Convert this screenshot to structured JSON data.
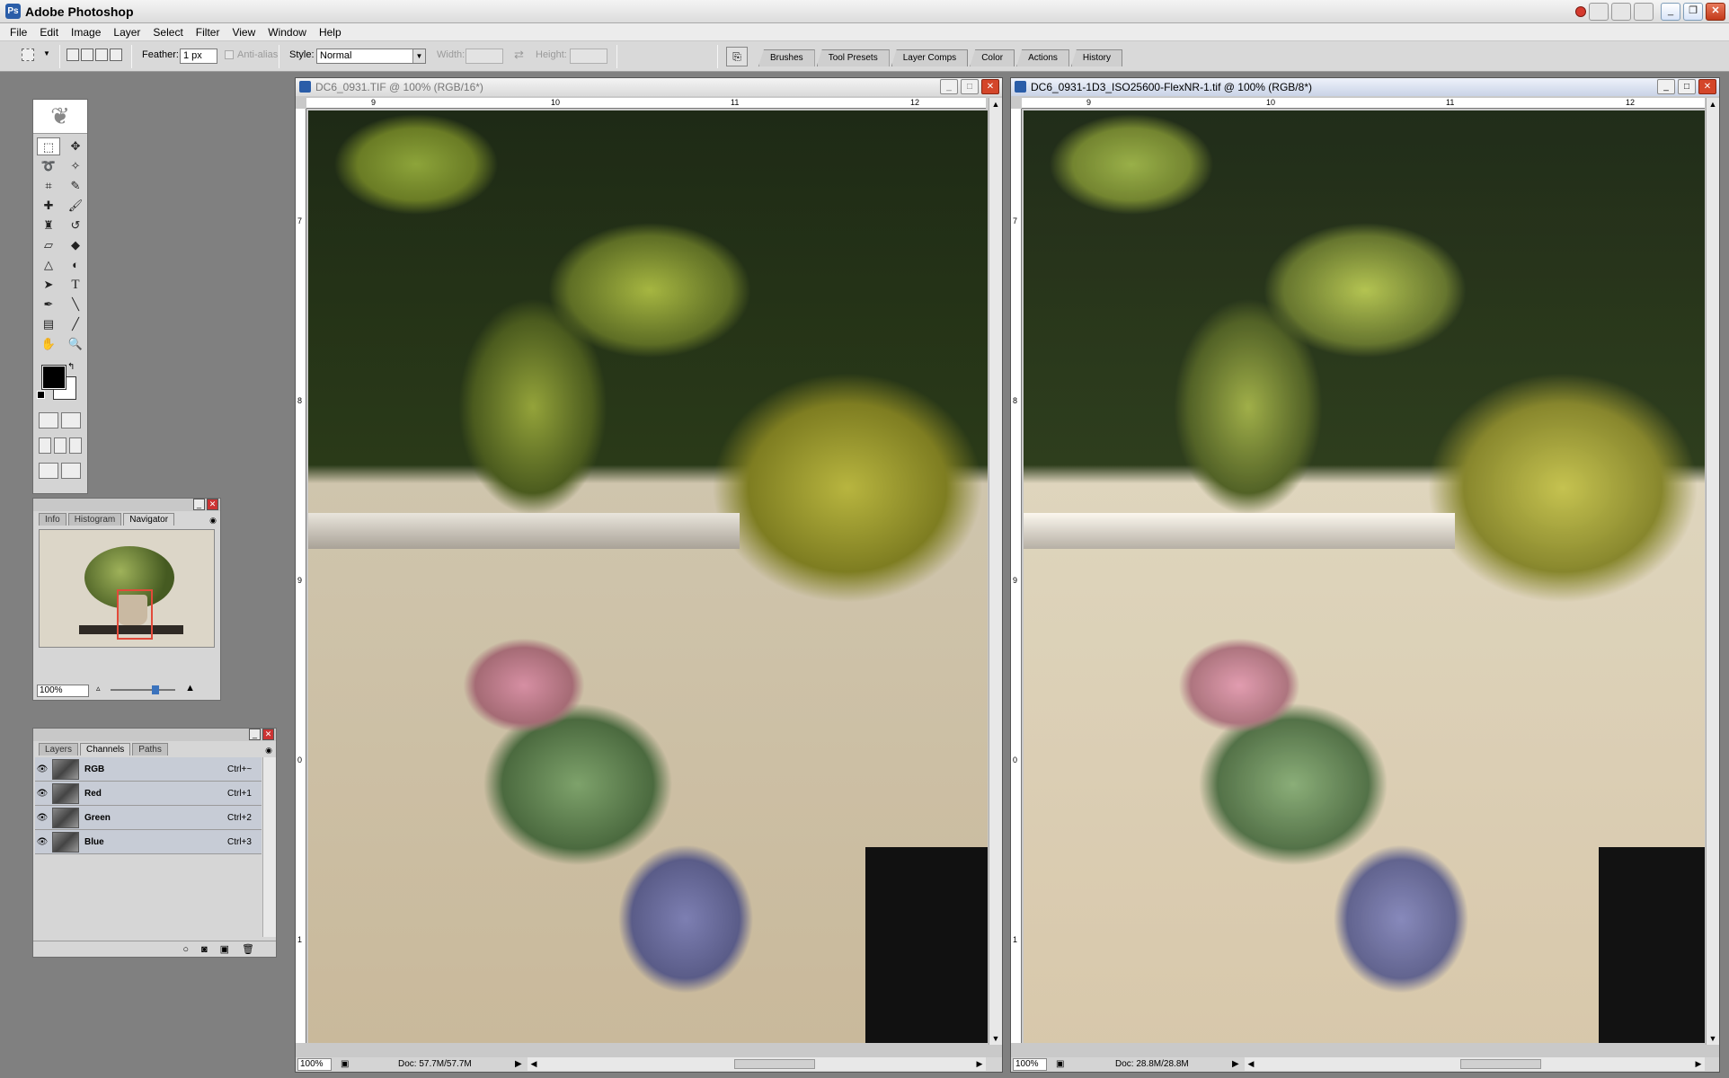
{
  "app": {
    "title": "Adobe Photoshop"
  },
  "menu": [
    "File",
    "Edit",
    "Image",
    "Layer",
    "Select",
    "Filter",
    "View",
    "Window",
    "Help"
  ],
  "options": {
    "feather_label": "Feather:",
    "feather_value": "1 px",
    "antialias_label": "Anti-alias",
    "style_label": "Style:",
    "style_value": "Normal",
    "width_label": "Width:",
    "height_label": "Height:"
  },
  "palette_well": [
    "Brushes",
    "Tool Presets",
    "Layer Comps",
    "Color",
    "Actions",
    "History"
  ],
  "navigator_panel": {
    "tabs": [
      "Info",
      "Histogram",
      "Navigator"
    ],
    "active_tab": "Navigator",
    "zoom": "100%"
  },
  "channels_panel": {
    "tabs": [
      "Layers",
      "Channels",
      "Paths"
    ],
    "active_tab": "Channels",
    "channels": [
      {
        "name": "RGB",
        "shortcut": "Ctrl+~"
      },
      {
        "name": "Red",
        "shortcut": "Ctrl+1"
      },
      {
        "name": "Green",
        "shortcut": "Ctrl+2"
      },
      {
        "name": "Blue",
        "shortcut": "Ctrl+3"
      }
    ]
  },
  "documents": [
    {
      "title": "DC6_0931.TIF @ 100% (RGB/16*)",
      "zoom": "100%",
      "doc_size": "Doc: 57.7M/57.7M",
      "active": false,
      "ruler_h": [
        "9",
        "10",
        "11",
        "12"
      ],
      "ruler_v": [
        "7",
        "8",
        "9",
        "0",
        "1"
      ]
    },
    {
      "title": "DC6_0931-1D3_ISO25600-FlexNR-1.tif @ 100% (RGB/8*)",
      "zoom": "100%",
      "doc_size": "Doc: 28.8M/28.8M",
      "active": true,
      "ruler_h": [
        "9",
        "10",
        "11",
        "12"
      ],
      "ruler_v": [
        "7",
        "8",
        "9",
        "0",
        "1"
      ]
    }
  ]
}
